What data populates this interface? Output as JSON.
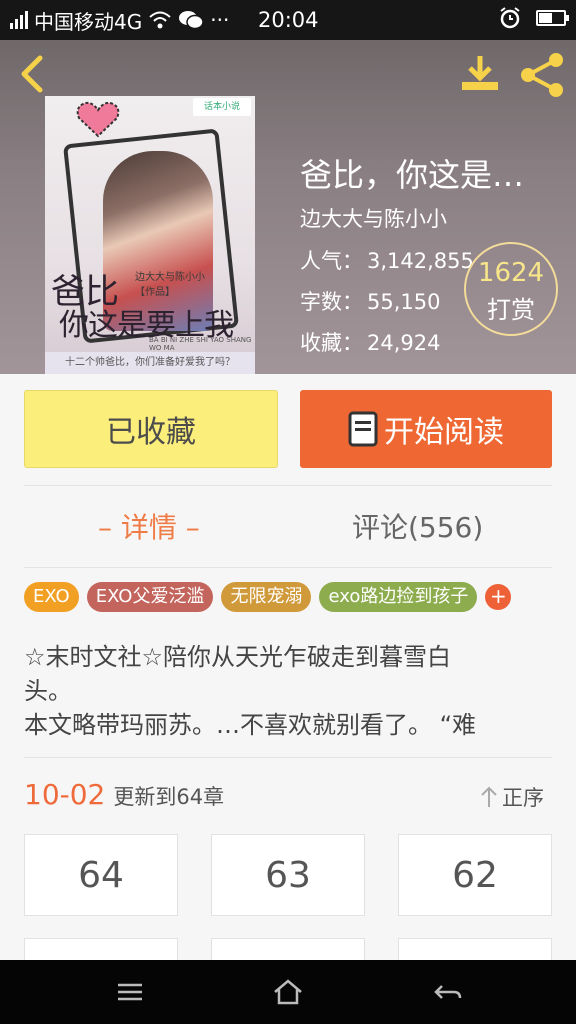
{
  "status_bar": {
    "carrier": "中国移动4G",
    "time": "20:04",
    "battery_level": 0.55
  },
  "header": {
    "back_icon": "chevron-left-icon",
    "download_icon": "download-icon",
    "share_icon": "share-icon"
  },
  "cover": {
    "publisher_label": "话本小说",
    "title_line1": "爸比",
    "title_line2": "你这是要上我吗",
    "author_small": "边大大与陈小小",
    "works_label": "【作品】",
    "pinyin": "BA BI NI ZHE SHI YAO SHANG WO MA",
    "tagline": "十二个帅爸比，你们准备好爱我了吗？"
  },
  "book": {
    "title": "爸比，你这是…",
    "author": "边大大与陈小小",
    "popularity_label": "人气：",
    "popularity": "3,142,855",
    "words_label": "字数：",
    "words": "55,150",
    "favorites_label": "收藏：",
    "favorites": "24,924"
  },
  "reward": {
    "count": "1624",
    "label": "打赏"
  },
  "actions": {
    "favorite_label": "已收藏",
    "read_label": "开始阅读"
  },
  "tabs": {
    "detail": "– 详情 –",
    "comments": "评论(556)"
  },
  "tags": [
    {
      "label": "EXO",
      "color": "#f2a024"
    },
    {
      "label": "EXO父爱泛滥",
      "color": "#c3655c"
    },
    {
      "label": "无限宠溺",
      "color": "#d0993a"
    },
    {
      "label": "exo路边捡到孩子",
      "color": "#8dac4e"
    }
  ],
  "tag_more": "+",
  "intro": {
    "line1": "☆末时文社☆陪你从天光乍破走到暮雪白",
    "line2": "头。",
    "line3": "本文略带玛丽苏。…不喜欢就别看了。 “难"
  },
  "update": {
    "date": "10-02",
    "text": "更新到64章",
    "sort_label": "正序"
  },
  "chapters": [
    "64",
    "63",
    "62",
    "",
    "",
    ""
  ],
  "colors": {
    "accent": "#ef6733",
    "favorite_bg": "#fbee7b"
  }
}
